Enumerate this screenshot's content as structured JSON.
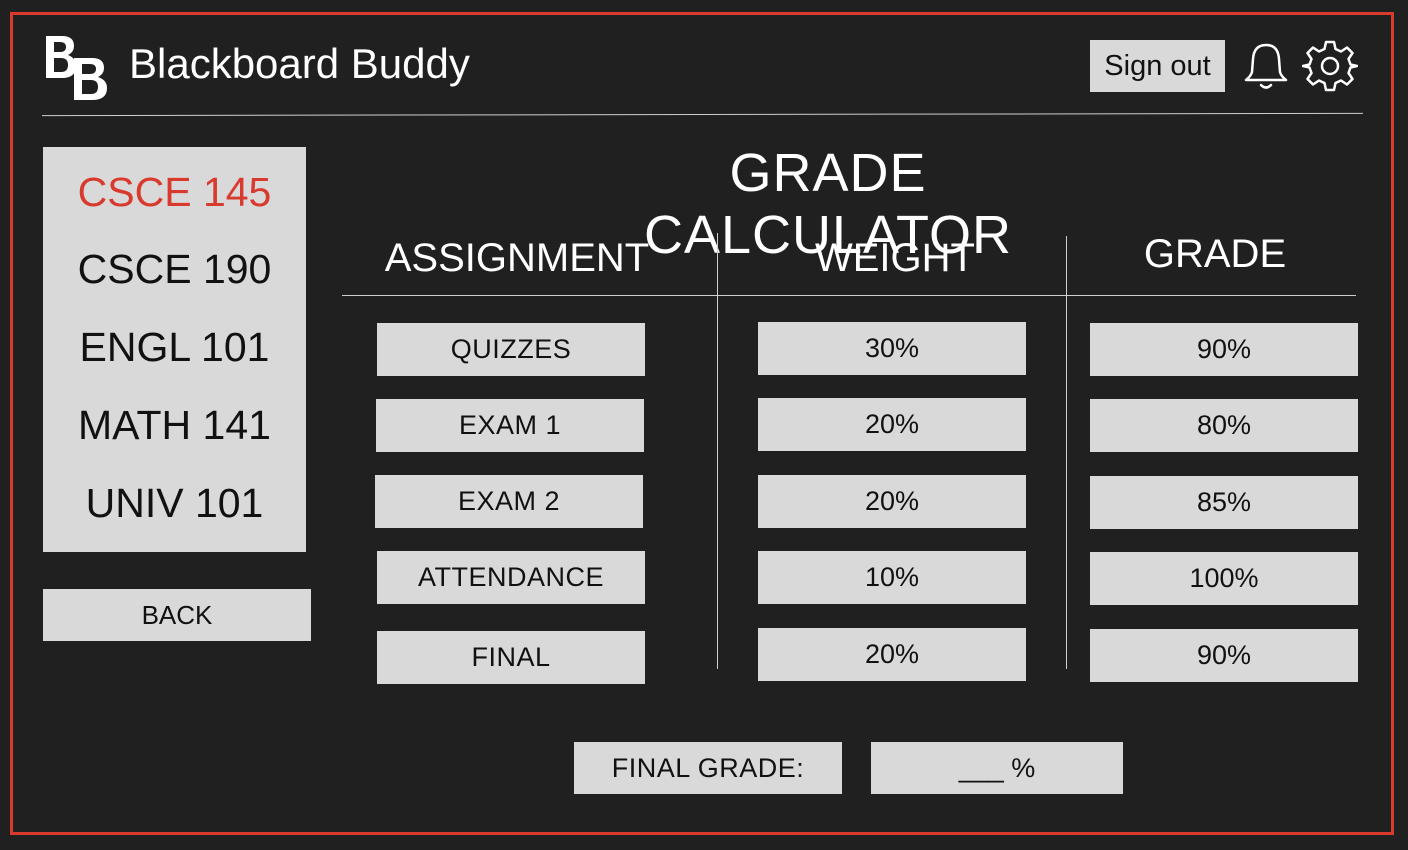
{
  "app": {
    "title": "Blackboard Buddy",
    "logo_letters": "BB",
    "accent_color": "#d83a2e",
    "background_color": "#202020",
    "panel_color": "#d9d9d9"
  },
  "header": {
    "signout_label": "Sign out",
    "icons": [
      "bell-icon",
      "gear-icon"
    ]
  },
  "sidebar": {
    "courses": [
      {
        "label": "CSCE 145",
        "active": true
      },
      {
        "label": "CSCE 190",
        "active": false
      },
      {
        "label": "ENGL 101",
        "active": false
      },
      {
        "label": "MATH 141",
        "active": false
      },
      {
        "label": "UNIV 101",
        "active": false
      }
    ],
    "back_label": "BACK"
  },
  "main": {
    "title": "GRADE CALCULATOR",
    "columns": [
      "ASSIGNMENT",
      "WEIGHT",
      "GRADE"
    ],
    "rows": [
      {
        "assignment": "QUIZZES",
        "weight": "30%",
        "grade": "90%"
      },
      {
        "assignment": "EXAM 1",
        "weight": "20%",
        "grade": "80%"
      },
      {
        "assignment": "EXAM 2",
        "weight": "20%",
        "grade": "85%"
      },
      {
        "assignment": "ATTENDANCE",
        "weight": "10%",
        "grade": "100%"
      },
      {
        "assignment": "FINAL",
        "weight": "20%",
        "grade": "90%"
      }
    ],
    "final_grade_label": "FINAL GRADE:",
    "final_grade_value": "___ %"
  }
}
